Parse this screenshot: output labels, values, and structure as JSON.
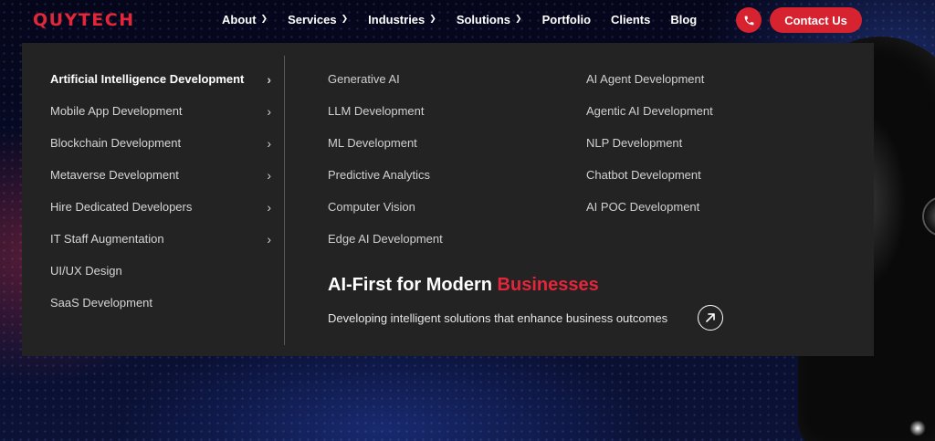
{
  "brand": {
    "logo_text": "QUYTECH",
    "accent_color": "#e3263a"
  },
  "nav": {
    "items": [
      {
        "label": "About",
        "has_dropdown": true
      },
      {
        "label": "Services",
        "has_dropdown": true
      },
      {
        "label": "Industries",
        "has_dropdown": true
      },
      {
        "label": "Solutions",
        "has_dropdown": true
      },
      {
        "label": "Portfolio",
        "has_dropdown": false
      },
      {
        "label": "Clients",
        "has_dropdown": false
      },
      {
        "label": "Blog",
        "has_dropdown": false
      }
    ],
    "phone_icon": "phone-icon",
    "contact_label": "Contact Us"
  },
  "menu": {
    "categories": [
      {
        "label": "Artificial Intelligence Development",
        "has_arrow": true,
        "active": true
      },
      {
        "label": "Mobile App Development",
        "has_arrow": true
      },
      {
        "label": "Blockchain Development",
        "has_arrow": true
      },
      {
        "label": "Metaverse Development",
        "has_arrow": true
      },
      {
        "label": "Hire Dedicated Developers",
        "has_arrow": true
      },
      {
        "label": "IT Staff Augmentation",
        "has_arrow": true
      },
      {
        "label": "UI/UX Design",
        "has_arrow": false
      },
      {
        "label": "SaaS Development",
        "has_arrow": false
      }
    ],
    "column_a": [
      "Generative AI",
      "LLM Development",
      "ML Development",
      "Predictive Analytics",
      "Computer Vision",
      "Edge AI Development"
    ],
    "column_b": [
      "AI Agent Development",
      "Agentic AI Development",
      "NLP Development",
      "Chatbot Development",
      "AI POC Development"
    ],
    "promo": {
      "title_main": "AI-First for Modern ",
      "title_accent": "Businesses",
      "subtitle": "Developing intelligent solutions that enhance business outcomes",
      "arrow_icon": "arrow-up-right-icon"
    }
  }
}
